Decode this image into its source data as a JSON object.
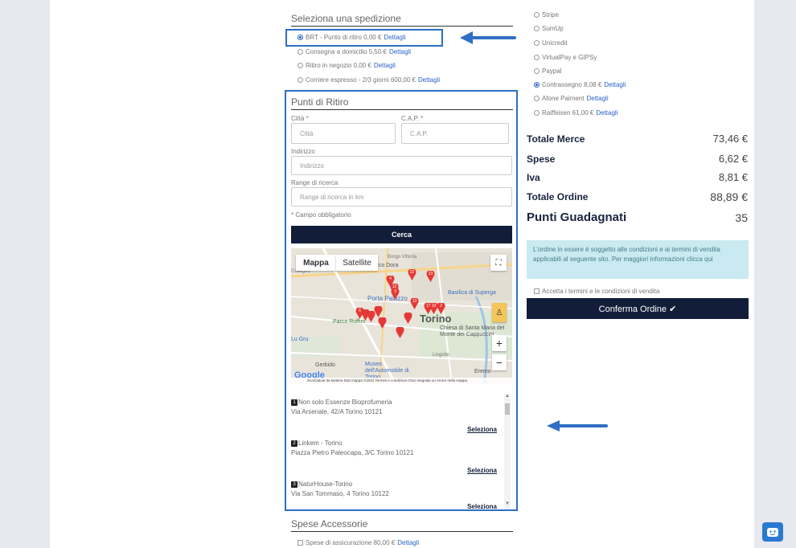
{
  "shipping": {
    "title": "Seleziona una spedizione",
    "options": [
      {
        "label": "BRT - Punto di ritiro 0,00 €",
        "link": "Dettagli",
        "selected": true
      },
      {
        "label": "Consegna a domicilio 5,50 €",
        "link": "Dettagli",
        "selected": false
      },
      {
        "label": "Ritiro in negozio 0,00 €",
        "link": "Dettagli",
        "selected": false
      },
      {
        "label": "Corriere espresso - 2/3 giorni 600,00 €",
        "link": "Dettagli",
        "selected": false
      }
    ]
  },
  "pickup": {
    "title": "Punti di Ritiro",
    "city_label": "Città *",
    "city_placeholder": "Città",
    "cap_label": "C.A.P. *",
    "cap_placeholder": "C.A.P.",
    "address_label": "Indirizzo",
    "address_placeholder": "Indirizzo",
    "range_label": "Range di ricerca",
    "range_placeholder": "Range di ricerca in km",
    "required_note": "* Campo obbligatorio",
    "search_button": "Cerca"
  },
  "map": {
    "tab_map": "Mappa",
    "tab_satellite": "Satellite",
    "labels": [
      "Parco Dora",
      "Porta Palazzo",
      "Torino",
      "Parco Ruffini",
      "Museo dell'Automobile di Torino",
      "Basilica di Superga",
      "Chiesa di Santa Maria del Monte dei Cappuccini",
      "Gerbido",
      "Eremo",
      "Lingotto",
      "Borgo Vittoria",
      "Collegno",
      "Lu Gru"
    ],
    "footer": "Scorciatoie da tastiera   Dati mappa ©2022   Termini e condizioni d'uso   Segnala un errore nella mappa",
    "google": "Google",
    "pins": [
      "22",
      "23",
      "4",
      "12",
      "3",
      "13",
      "17",
      "10",
      "2",
      "6"
    ]
  },
  "stores": [
    {
      "num": "1",
      "name": "Non solo Essenze Bioprofumeria",
      "address": "Via Arsenale, 42/A Torino 10121",
      "select": "Seleziona"
    },
    {
      "num": "2",
      "name": "Linkem - Torino",
      "address": "Piazza Pietro Paleocapa, 3/C Torino 10121",
      "select": "Seleziona"
    },
    {
      "num": "3",
      "name": "NaturHouse-Torino",
      "address": "Via San Tommaso, 4 Torino 10122",
      "select": "Seleziona"
    }
  ],
  "extras": {
    "title": "Spese Accessorie",
    "insurance": {
      "label": "Spese di assicurazione 80,00 €",
      "link": "Dettagli"
    }
  },
  "payments": [
    {
      "label": "Stripe",
      "link": "",
      "selected": false
    },
    {
      "label": "SumUp",
      "link": "",
      "selected": false
    },
    {
      "label": "Unicredit",
      "link": "",
      "selected": false
    },
    {
      "label": "VirtualPay e GIPSy",
      "link": "",
      "selected": false
    },
    {
      "label": "Paypal",
      "link": "",
      "selected": false
    },
    {
      "label": "Contrassegno 8,08 €",
      "link": "Dettagli",
      "selected": true
    },
    {
      "label": "Afone Paiment",
      "link": "Dettagli",
      "selected": false
    },
    {
      "label": "Raiffeisen 61,00 €",
      "link": "Dettagli",
      "selected": false
    }
  ],
  "summary": {
    "merchandise_label": "Totale Merce",
    "merchandise_value": "73,46 €",
    "expenses_label": "Spese",
    "expenses_value": "6,62 €",
    "vat_label": "Iva",
    "vat_value": "8,81 €",
    "total_label": "Totale Ordine",
    "total_value": "88,89 €",
    "points_label": "Punti Guadagnati",
    "points_value": "35"
  },
  "terms": {
    "info": "L'ordine in essere è soggetto alle condizioni e ai termini di vendita applicabili al seguente sito. Per maggiori informazioni clicca qui",
    "accept": "Accetta i termini e le condizioni di vendita",
    "confirm_button": "Conferma Ordine ✔"
  },
  "colors": {
    "accent": "#2a63c9",
    "dark": "#121d3a",
    "annotation": "#2f6fc4",
    "pin": "#e53935"
  }
}
